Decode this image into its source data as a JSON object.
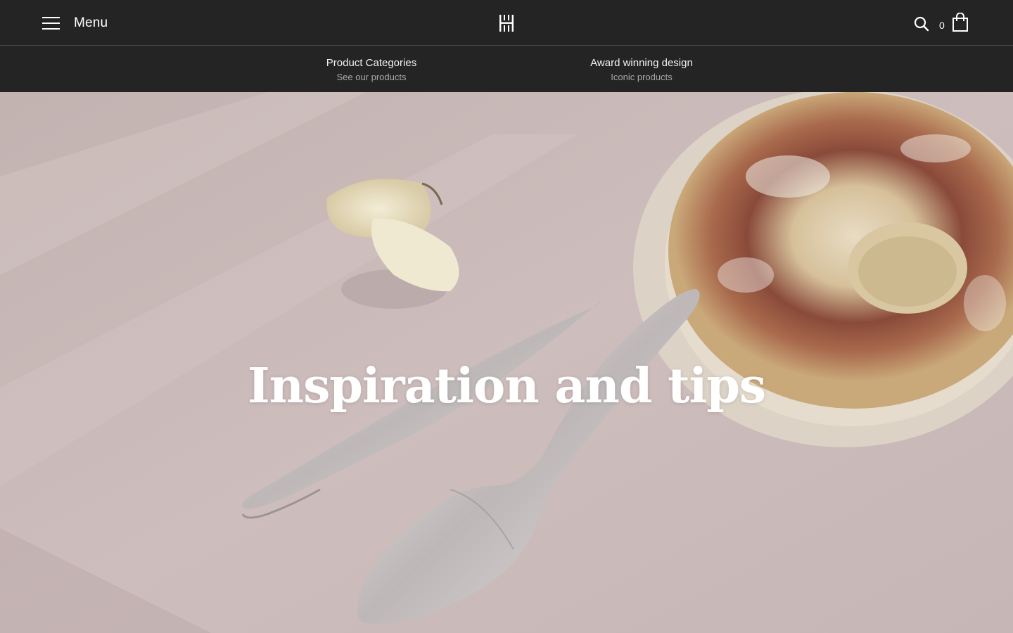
{
  "header": {
    "menu_label": "Menu",
    "cart_count": "0",
    "icons": {
      "menu": "hamburger-icon",
      "logo": "brand-logo",
      "search": "search-icon",
      "cart": "shopping-bag-icon"
    }
  },
  "subnav": {
    "items": [
      {
        "title": "Product Categories",
        "subtitle": "See our products"
      },
      {
        "title": "Award winning design",
        "subtitle": "Iconic products"
      }
    ]
  },
  "hero": {
    "title": "Inspiration and tips"
  },
  "colors": {
    "header_bg": "#242424",
    "hero_bg": "#c9b9b8",
    "text": "#ffffff",
    "subtext": "#a9a9a9"
  }
}
